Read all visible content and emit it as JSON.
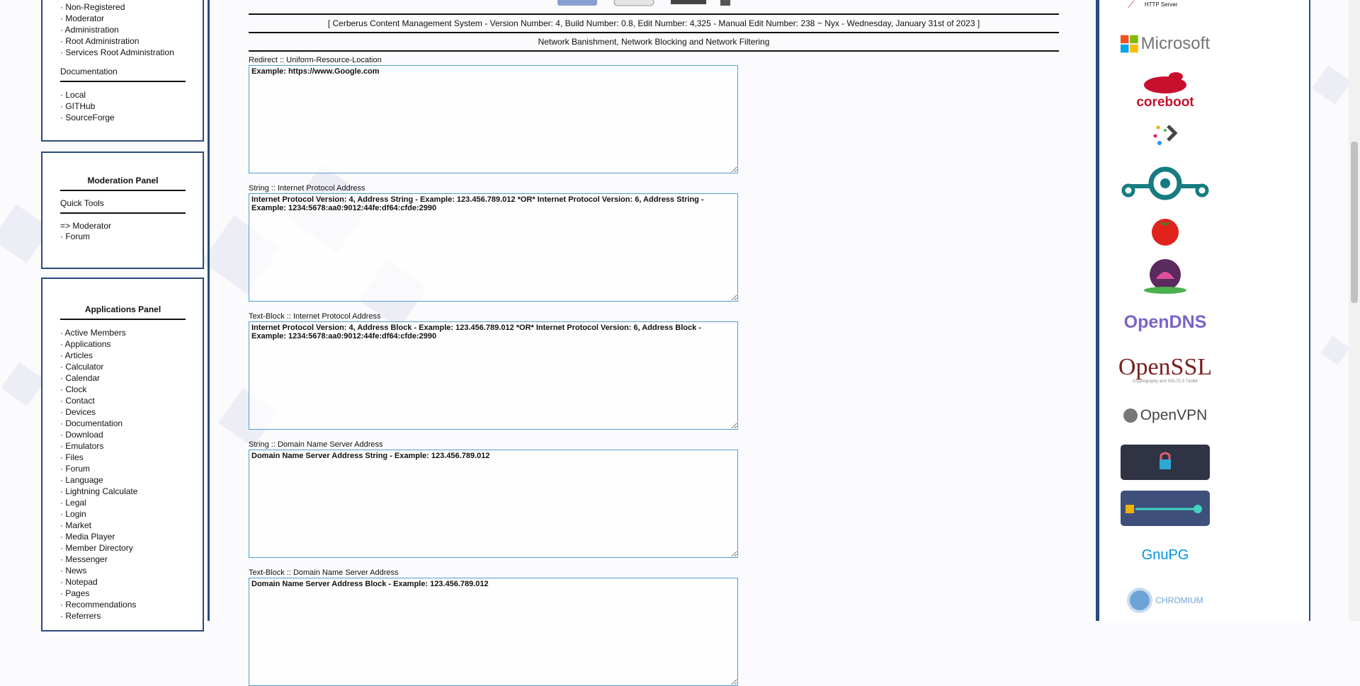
{
  "header_bar": "[ Cerberus Content Management System - Version Number: 4, Build Number: 0.8, Edit Number: 4,325 - Manual Edit Number: 238 ~ Nyx - Wednesday, January 31st of 2023 ]",
  "page_title": "Network Banishment, Network Blocking and Network Filtering",
  "access_panel": {
    "items": [
      "Non-Registered",
      "Moderator",
      "Administration",
      "Root Administration",
      "Services Root Administration"
    ],
    "documentation_title": "Documentation",
    "documentation_items": [
      "Local",
      "GITHub",
      "SourceForge"
    ]
  },
  "moderation_panel": {
    "title": "Moderation Panel",
    "quick_tools_title": "Quick Tools",
    "items": [
      "=> Moderator",
      "· Forum"
    ]
  },
  "applications_panel": {
    "title": "Applications Panel",
    "items": [
      "Active Members",
      "Applications",
      "Articles",
      "Calculator",
      "Calendar",
      "Clock",
      "Contact",
      "Devices",
      "Documentation",
      "Download",
      "Emulators",
      "Files",
      "Forum",
      "Language",
      "Lightning Calculate",
      "Legal",
      "Login",
      "Market",
      "Media Player",
      "Member Directory",
      "Messenger",
      "News",
      "Notepad",
      "Pages",
      "Recommendations",
      "Referrers"
    ]
  },
  "fields": [
    {
      "label": "Redirect :: Uniform-Resource-Location",
      "value": "Example: https://www.Google.com"
    },
    {
      "label": "String :: Internet Protocol Address",
      "value": "Internet Protocol Version: 4, Address String - Example: 123.456.789.012 *OR* Internet Protocol Version: 6, Address String - Example: 1234:5678:aa0:9012:44fe:df64:cfde:2990"
    },
    {
      "label": "Text-Block :: Internet Protocol Address",
      "value": "Internet Protocol Version: 4, Address Block - Example: 123.456.789.012 *OR* Internet Protocol Version: 6, Address Block - Example: 1234:5678:aa0:9012:44fe:df64:cfde:2990"
    },
    {
      "label": "String :: Domain Name Server Address",
      "value": "Domain Name Server Address String - Example: 123.456.789.012"
    },
    {
      "label": "Text-Block :: Domain Name Server Address",
      "value": "Domain Name Server Address Block - Example: 123.456.789.012"
    }
  ],
  "logos": {
    "http_server": "HTTP Server",
    "microsoft": "Microsoft",
    "coreboot": "coreboot",
    "opendns": "OpenDNS",
    "openssl": "OpenSSL",
    "openssl_sub": "Cryptography and SSL/TLS Toolkit",
    "openvpn": "OpenVPN",
    "gnupg": "GnuPG",
    "chromium": "CHROMIUM"
  },
  "colors": {
    "accent": "#2c4a7c",
    "textarea_border": "#4a9fd5"
  }
}
